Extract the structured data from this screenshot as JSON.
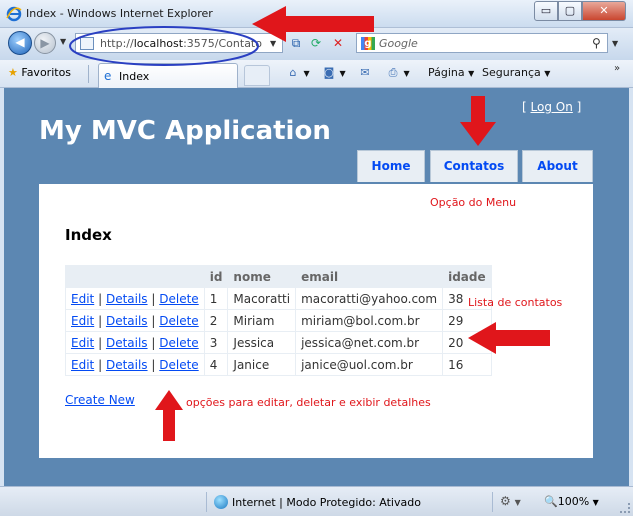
{
  "window": {
    "title": "Index - Windows Internet Explorer",
    "controls": {
      "minimize": "▭",
      "maximize": "▢",
      "close": "✕"
    }
  },
  "navigation": {
    "back_icon": "arrow-left-icon",
    "url_prefix": "http://",
    "url_host": "localhost",
    "url_rest": ":3575/Contato",
    "search_placeholder": "Google"
  },
  "favorites_bar": {
    "favorites_label": "Favoritos",
    "tab_label": "Index",
    "commands": {
      "page": "Página",
      "security": "Segurança"
    }
  },
  "site": {
    "login_open": "[",
    "login_label": "Log On",
    "login_close": "]",
    "title": "My MVC Application",
    "menu": [
      {
        "label": "Home"
      },
      {
        "label": "Contatos"
      },
      {
        "label": "About"
      }
    ],
    "page_title": "Index",
    "table": {
      "headers": [
        "",
        "id",
        "nome",
        "email",
        "idade"
      ],
      "action_labels": {
        "edit": "Edit",
        "details": "Details",
        "delete": "Delete",
        "sep": "|"
      },
      "rows": [
        {
          "id": "1",
          "nome": "Macoratti",
          "email": "macoratti@yahoo.com",
          "idade": "38"
        },
        {
          "id": "2",
          "nome": "Miriam",
          "email": "miriam@bol.com.br",
          "idade": "29"
        },
        {
          "id": "3",
          "nome": "Jessica",
          "email": "jessica@net.com.br",
          "idade": "20"
        },
        {
          "id": "4",
          "nome": "Janice",
          "email": "janice@uol.com.br",
          "idade": "16"
        }
      ]
    },
    "create_new": "Create New"
  },
  "annotations": {
    "menu_option": "Opção do Menu",
    "contact_list": "Lista de contatos",
    "options": "opções para editar, deletar e exibir detalhes"
  },
  "statusbar": {
    "zone": "Internet | Modo Protegido: Ativado",
    "zoom": "100%"
  },
  "colors": {
    "site_background": "#5c87b2",
    "link": "#034af3",
    "annotation": "#e0161b"
  }
}
